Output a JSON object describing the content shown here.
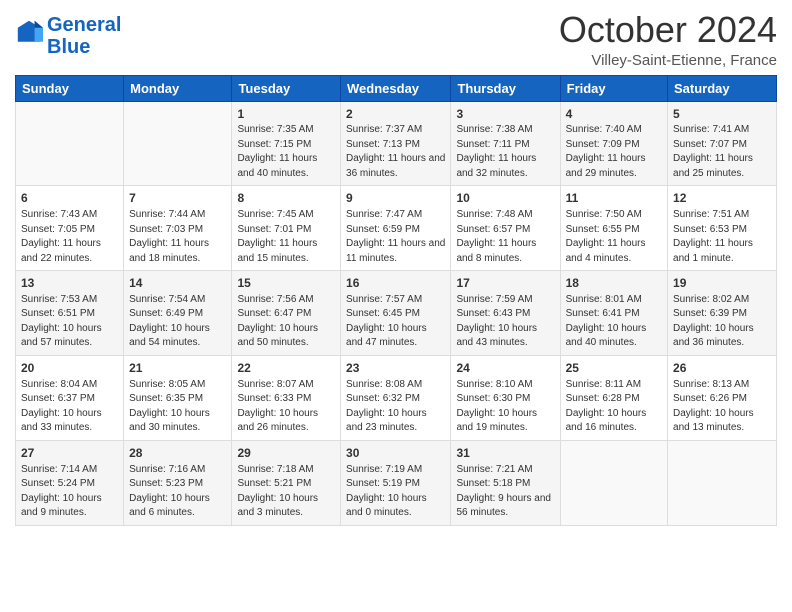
{
  "logo": {
    "line1": "General",
    "line2": "Blue"
  },
  "header": {
    "month": "October 2024",
    "location": "Villey-Saint-Etienne, France"
  },
  "weekdays": [
    "Sunday",
    "Monday",
    "Tuesday",
    "Wednesday",
    "Thursday",
    "Friday",
    "Saturday"
  ],
  "weeks": [
    [
      {
        "day": "",
        "content": ""
      },
      {
        "day": "",
        "content": ""
      },
      {
        "day": "1",
        "content": "Sunrise: 7:35 AM\nSunset: 7:15 PM\nDaylight: 11 hours and 40 minutes."
      },
      {
        "day": "2",
        "content": "Sunrise: 7:37 AM\nSunset: 7:13 PM\nDaylight: 11 hours and 36 minutes."
      },
      {
        "day": "3",
        "content": "Sunrise: 7:38 AM\nSunset: 7:11 PM\nDaylight: 11 hours and 32 minutes."
      },
      {
        "day": "4",
        "content": "Sunrise: 7:40 AM\nSunset: 7:09 PM\nDaylight: 11 hours and 29 minutes."
      },
      {
        "day": "5",
        "content": "Sunrise: 7:41 AM\nSunset: 7:07 PM\nDaylight: 11 hours and 25 minutes."
      }
    ],
    [
      {
        "day": "6",
        "content": "Sunrise: 7:43 AM\nSunset: 7:05 PM\nDaylight: 11 hours and 22 minutes."
      },
      {
        "day": "7",
        "content": "Sunrise: 7:44 AM\nSunset: 7:03 PM\nDaylight: 11 hours and 18 minutes."
      },
      {
        "day": "8",
        "content": "Sunrise: 7:45 AM\nSunset: 7:01 PM\nDaylight: 11 hours and 15 minutes."
      },
      {
        "day": "9",
        "content": "Sunrise: 7:47 AM\nSunset: 6:59 PM\nDaylight: 11 hours and 11 minutes."
      },
      {
        "day": "10",
        "content": "Sunrise: 7:48 AM\nSunset: 6:57 PM\nDaylight: 11 hours and 8 minutes."
      },
      {
        "day": "11",
        "content": "Sunrise: 7:50 AM\nSunset: 6:55 PM\nDaylight: 11 hours and 4 minutes."
      },
      {
        "day": "12",
        "content": "Sunrise: 7:51 AM\nSunset: 6:53 PM\nDaylight: 11 hours and 1 minute."
      }
    ],
    [
      {
        "day": "13",
        "content": "Sunrise: 7:53 AM\nSunset: 6:51 PM\nDaylight: 10 hours and 57 minutes."
      },
      {
        "day": "14",
        "content": "Sunrise: 7:54 AM\nSunset: 6:49 PM\nDaylight: 10 hours and 54 minutes."
      },
      {
        "day": "15",
        "content": "Sunrise: 7:56 AM\nSunset: 6:47 PM\nDaylight: 10 hours and 50 minutes."
      },
      {
        "day": "16",
        "content": "Sunrise: 7:57 AM\nSunset: 6:45 PM\nDaylight: 10 hours and 47 minutes."
      },
      {
        "day": "17",
        "content": "Sunrise: 7:59 AM\nSunset: 6:43 PM\nDaylight: 10 hours and 43 minutes."
      },
      {
        "day": "18",
        "content": "Sunrise: 8:01 AM\nSunset: 6:41 PM\nDaylight: 10 hours and 40 minutes."
      },
      {
        "day": "19",
        "content": "Sunrise: 8:02 AM\nSunset: 6:39 PM\nDaylight: 10 hours and 36 minutes."
      }
    ],
    [
      {
        "day": "20",
        "content": "Sunrise: 8:04 AM\nSunset: 6:37 PM\nDaylight: 10 hours and 33 minutes."
      },
      {
        "day": "21",
        "content": "Sunrise: 8:05 AM\nSunset: 6:35 PM\nDaylight: 10 hours and 30 minutes."
      },
      {
        "day": "22",
        "content": "Sunrise: 8:07 AM\nSunset: 6:33 PM\nDaylight: 10 hours and 26 minutes."
      },
      {
        "day": "23",
        "content": "Sunrise: 8:08 AM\nSunset: 6:32 PM\nDaylight: 10 hours and 23 minutes."
      },
      {
        "day": "24",
        "content": "Sunrise: 8:10 AM\nSunset: 6:30 PM\nDaylight: 10 hours and 19 minutes."
      },
      {
        "day": "25",
        "content": "Sunrise: 8:11 AM\nSunset: 6:28 PM\nDaylight: 10 hours and 16 minutes."
      },
      {
        "day": "26",
        "content": "Sunrise: 8:13 AM\nSunset: 6:26 PM\nDaylight: 10 hours and 13 minutes."
      }
    ],
    [
      {
        "day": "27",
        "content": "Sunrise: 7:14 AM\nSunset: 5:24 PM\nDaylight: 10 hours and 9 minutes."
      },
      {
        "day": "28",
        "content": "Sunrise: 7:16 AM\nSunset: 5:23 PM\nDaylight: 10 hours and 6 minutes."
      },
      {
        "day": "29",
        "content": "Sunrise: 7:18 AM\nSunset: 5:21 PM\nDaylight: 10 hours and 3 minutes."
      },
      {
        "day": "30",
        "content": "Sunrise: 7:19 AM\nSunset: 5:19 PM\nDaylight: 10 hours and 0 minutes."
      },
      {
        "day": "31",
        "content": "Sunrise: 7:21 AM\nSunset: 5:18 PM\nDaylight: 9 hours and 56 minutes."
      },
      {
        "day": "",
        "content": ""
      },
      {
        "day": "",
        "content": ""
      }
    ]
  ]
}
